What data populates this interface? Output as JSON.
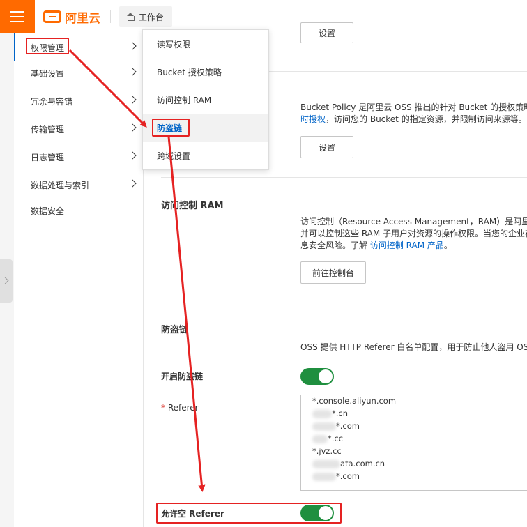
{
  "header": {
    "logo_text": "阿里云",
    "workbench_label": "工作台"
  },
  "sidebar": {
    "items": [
      {
        "label": "权限管理",
        "chevron": true
      },
      {
        "label": "基础设置",
        "chevron": true
      },
      {
        "label": "冗余与容错",
        "chevron": true
      },
      {
        "label": "传输管理",
        "chevron": true
      },
      {
        "label": "日志管理",
        "chevron": true
      },
      {
        "label": "数据处理与索引",
        "chevron": true
      },
      {
        "label": "数据安全",
        "chevron": false
      }
    ]
  },
  "dropdown": {
    "items": [
      {
        "label": "读写权限"
      },
      {
        "label": "Bucket 授权策略"
      },
      {
        "label": "访问控制 RAM"
      },
      {
        "label": "防盗链"
      },
      {
        "label": "跨域设置"
      }
    ]
  },
  "content": {
    "top_button": "设置",
    "bucket_policy": {
      "desc_line1": "Bucket Policy 是阿里云 OSS 推出的针对 Bucket 的授权策略，",
      "desc_line2_link": "时授权",
      "desc_line2_rest": "，访问您的 Bucket 的指定资源，并限制访问来源等。了",
      "button": "设置"
    },
    "ram": {
      "title": "访问控制 RAM",
      "desc_line1": "访问控制（Resource Access Management，RAM）是阿里云提",
      "desc_line2": "并可以控制这些 RAM 子用户对资源的操作权限。当您的企业存",
      "desc_line3_pre": "息安全风险。了解 ",
      "desc_line3_link": "访问控制 RAM 产品",
      "desc_line3_post": "。",
      "button": "前往控制台"
    },
    "hotlink": {
      "title": "防盗链",
      "desc": "OSS 提供 HTTP Referer 白名单配置，用于防止他人盗用 OSS 数",
      "enable_label": "开启防盗链",
      "referer_label": "Referer",
      "referer_required_mark": "*",
      "referers": [
        "*.console.aliyun.com",
        "*.cn",
        "*.com",
        "*.cc",
        "*.jvz.cc",
        "ata.com.cn",
        "*.com"
      ],
      "allow_empty_label": "允许空 Referer"
    }
  },
  "colors": {
    "brand": "#ff6a00",
    "link": "#0064c8",
    "switch_on": "#1f8f3f",
    "annotation": "#e52222"
  }
}
